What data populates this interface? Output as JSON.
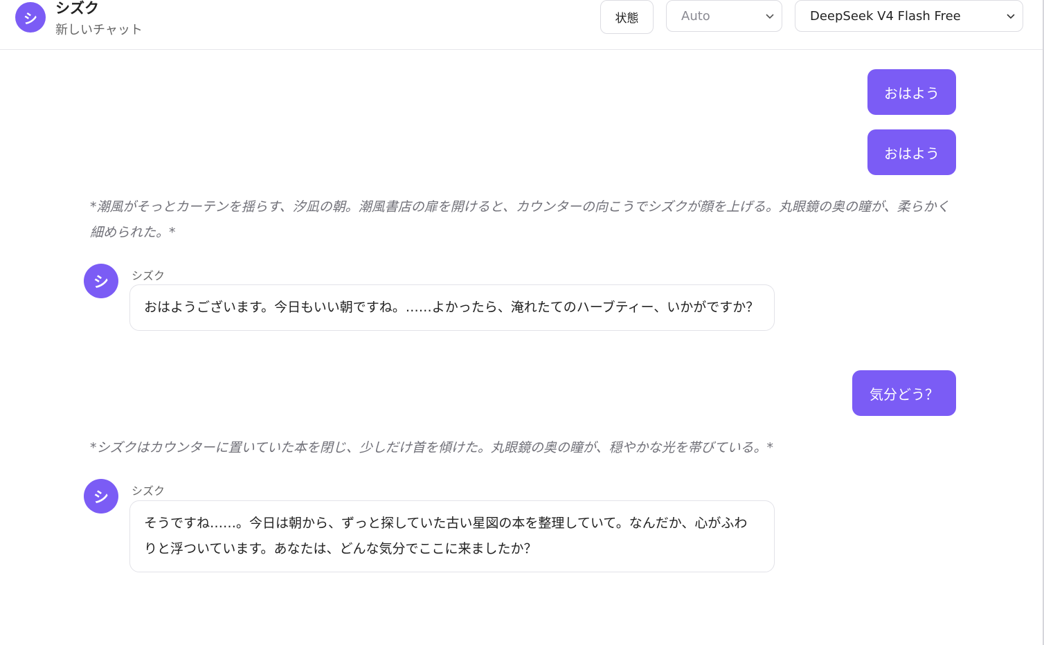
{
  "header": {
    "avatar_letter": "シ",
    "title": "シズク",
    "subtitle": "新しいチャット",
    "status_button": "状態",
    "mode_select": "Auto",
    "model_select": "DeepSeek V4 Flash Free"
  },
  "messages": [
    {
      "role": "user",
      "text": "おはよう"
    },
    {
      "role": "user",
      "text": "おはよう"
    },
    {
      "role": "narration",
      "text": "*潮風がそっとカーテンを揺らす、汐凪の朝。潮風書店の扉を開けると、カウンターの向こうでシズクが顔を上げる。丸眼鏡の奥の瞳が、柔らかく細められた。*"
    },
    {
      "role": "assistant",
      "avatar_letter": "シ",
      "speaker": "シズク",
      "text": "おはようございます。今日もいい朝ですね。……よかったら、淹れたてのハーブティー、いかがですか？"
    },
    {
      "role": "user",
      "text": "気分どう？"
    },
    {
      "role": "narration",
      "text": "*シズクはカウンターに置いていた本を閉じ、少しだけ首を傾けた。丸眼鏡の奥の瞳が、穏やかな光を帯びている。*"
    },
    {
      "role": "assistant",
      "avatar_letter": "シ",
      "speaker": "シズク",
      "text": "そうですね……。今日は朝から、ずっと探していた古い星図の本を整理していて。なんだか、心がふわりと浮ついています。あなたは、どんな気分でここに来ましたか？"
    }
  ],
  "colors": {
    "accent": "#7b5cf5",
    "narration": "#707078",
    "border": "#e2e2e8"
  }
}
